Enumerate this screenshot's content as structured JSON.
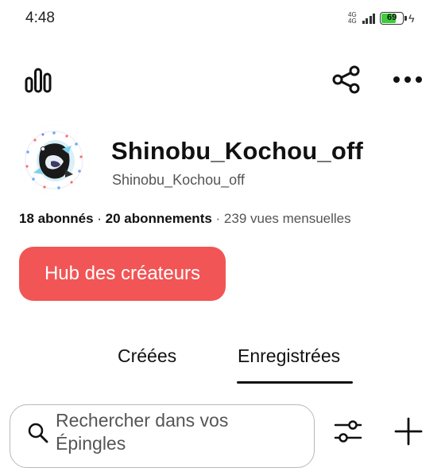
{
  "status_bar": {
    "time": "4:48",
    "network": "4G",
    "network_sub": "4G",
    "battery_percent": 69,
    "battery_label": "69",
    "charging": true
  },
  "toolbar": {
    "stats_icon": "bar-chart-icon",
    "share_icon": "share-icon",
    "more_icon": "more-horizontal-icon"
  },
  "profile": {
    "display_name": "Shinobu_Kochou_off",
    "handle": "Shinobu_Kochou_off",
    "followers": "18 abonnés",
    "separator1": " · ",
    "following": "20 abonnements",
    "separator2": " · ",
    "monthly_views": "239 vues mensuelles"
  },
  "hub_button": {
    "label": "Hub des créateurs"
  },
  "tabs": [
    {
      "label": "Créées",
      "selected": false
    },
    {
      "label": "Enregistrées",
      "selected": true
    }
  ],
  "search": {
    "placeholder": "Rechercher dans vos Épingles",
    "filter_icon": "sliders-icon",
    "add_icon": "plus-icon"
  },
  "colors": {
    "accent": "#f25555",
    "battery_fill": "#3ccc3c"
  }
}
